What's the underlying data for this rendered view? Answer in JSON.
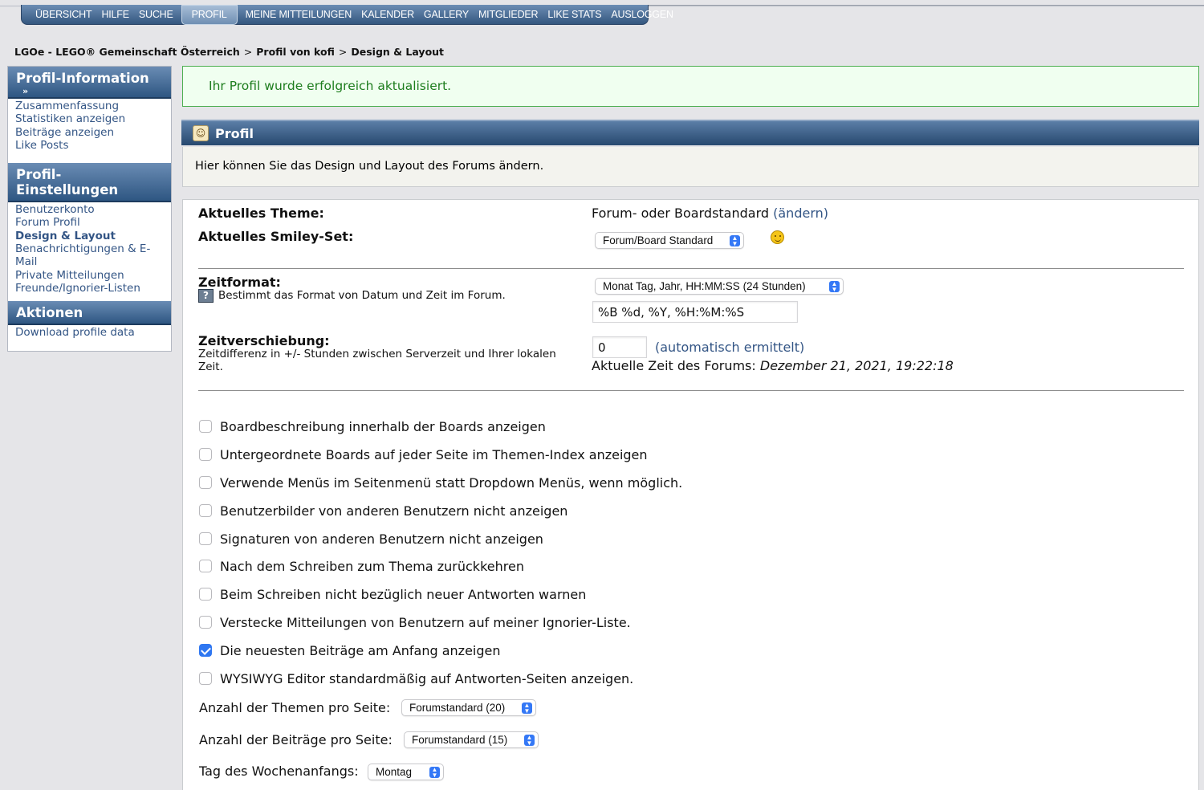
{
  "nav": {
    "items": [
      "ÜBERSICHT",
      "HILFE",
      "SUCHE",
      "PROFIL",
      "MEINE MITTEILUNGEN",
      "KALENDER",
      "GALLERY",
      "MITGLIEDER",
      "LIKE STATS",
      "AUSLOGGEN"
    ],
    "active": "PROFIL"
  },
  "breadcrumb": {
    "items": [
      "LGOe - LEGO® Gemeinschaft Österreich",
      "Profil von kofi",
      "Design & Layout"
    ],
    "separator": ">"
  },
  "sidebar": {
    "info_title": "Profil-Information",
    "info_arrow": "»",
    "info_items": [
      "Zusammenfassung",
      "Statistiken anzeigen",
      "Beiträge anzeigen",
      "Like Posts"
    ],
    "settings_title": "Profil-Einstellungen",
    "settings_items": [
      "Benutzerkonto",
      "Forum Profil",
      "Design & Layout",
      "Benachrichtigungen & E-Mail",
      "Private Mitteilungen",
      "Freunde/Ignorier-Listen"
    ],
    "actions_title": "Aktionen",
    "actions_items": [
      "Download profile data"
    ]
  },
  "success_message": "Ihr Profil wurde erfolgreich aktualisiert.",
  "profile_header": {
    "title": "Profil",
    "icon": "user-profile-icon"
  },
  "description": "Hier können Sie das Design und Layout des Forums ändern.",
  "theme": {
    "label": "Aktuelles Theme:",
    "value": "Forum- oder Boardstandard",
    "change_link": "(ändern)"
  },
  "smiley": {
    "label": "Aktuelles Smiley-Set:",
    "selected": "Forum/Board Standard",
    "preview_icon": "smiley-icon"
  },
  "time_format": {
    "label": "Zeitformat:",
    "help_icon": "help-icon",
    "help_glyph": "?",
    "description": "Bestimmt das Format von Datum und Zeit im Forum.",
    "selected": "Monat Tag, Jahr, HH:MM:SS (24 Stunden)",
    "format_value": "%B %d, %Y, %H:%M:%S"
  },
  "time_offset": {
    "label": "Zeitverschiebung:",
    "description": "Zeitdifferenz in +/- Stunden zwischen Serverzeit und Ihrer lokalen Zeit.",
    "value": "0",
    "auto_link": "(automatisch ermittelt)",
    "current_time_label": "Aktuelle Zeit des Forums:",
    "current_time": "Dezember 21, 2021, 19:22:18"
  },
  "options": [
    {
      "label": "Boardbeschreibung innerhalb der Boards anzeigen",
      "checked": false
    },
    {
      "label": "Untergeordnete Boards auf jeder Seite im Themen-Index anzeigen",
      "checked": false
    },
    {
      "label": "Verwende Menüs im Seitenmenü statt Dropdown Menüs, wenn möglich.",
      "checked": false
    },
    {
      "label": "Benutzerbilder von anderen Benutzern nicht anzeigen",
      "checked": false
    },
    {
      "label": "Signaturen von anderen Benutzern nicht anzeigen",
      "checked": false
    },
    {
      "label": "Nach dem Schreiben zum Thema zurückkehren",
      "checked": false
    },
    {
      "label": "Beim Schreiben nicht bezüglich neuer Antworten warnen",
      "checked": false
    },
    {
      "label": "Verstecke Mitteilungen von Benutzern auf meiner Ignorier-Liste.",
      "checked": false
    },
    {
      "label": "Die neuesten Beiträge am Anfang anzeigen",
      "checked": true
    },
    {
      "label": "WYSIWYG Editor standardmäßig auf Antworten-Seiten anzeigen.",
      "checked": false
    }
  ],
  "topics_per_page": {
    "label": "Anzahl der Themen pro Seite:",
    "selected": "Forumstandard (20)"
  },
  "posts_per_page": {
    "label": "Anzahl der Beiträge pro Seite:",
    "selected": "Forumstandard (15)"
  },
  "week_start": {
    "label": "Tag des Wochenanfangs:",
    "selected": "Montag"
  },
  "colors": {
    "nav": "#34577f",
    "link": "#335585",
    "success_text": "#1e7d1e",
    "success_border": "#4caf50",
    "checkbox_checked": "#2f77f1"
  }
}
